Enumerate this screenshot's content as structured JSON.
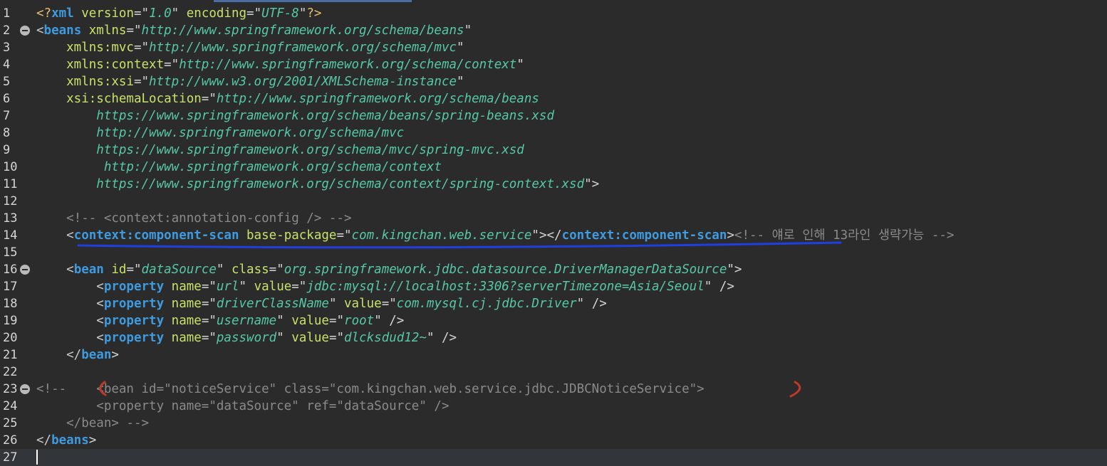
{
  "editor": {
    "colors": {
      "background": "#2b2b2b",
      "tag": "#3e9be0",
      "attribute": "#c7e26b",
      "value": "#56c7a8",
      "comment": "#8a8a8a"
    },
    "fold_icon": "fold-collapse-icon",
    "lines": [
      {
        "n": "1",
        "fold": false,
        "tokens": [
          {
            "t": "<?",
            "c": "pi"
          },
          {
            "t": "xml",
            "c": "tag"
          },
          {
            "t": " version",
            "c": "attr"
          },
          {
            "t": "=\"",
            "c": "punc"
          },
          {
            "t": "1.0",
            "c": "val"
          },
          {
            "t": "\"",
            "c": "punc"
          },
          {
            "t": " encoding",
            "c": "attr"
          },
          {
            "t": "=\"",
            "c": "punc"
          },
          {
            "t": "UTF-8",
            "c": "val"
          },
          {
            "t": "\"",
            "c": "punc"
          },
          {
            "t": "?>",
            "c": "pi"
          }
        ]
      },
      {
        "n": "2",
        "fold": true,
        "tokens": [
          {
            "t": "<",
            "c": "br"
          },
          {
            "t": "beans",
            "c": "tag"
          },
          {
            "t": " xmlns",
            "c": "attr"
          },
          {
            "t": "=\"",
            "c": "punc"
          },
          {
            "t": "http://www.springframework.org/schema/beans",
            "c": "val"
          },
          {
            "t": "\"",
            "c": "punc"
          }
        ]
      },
      {
        "n": "3",
        "fold": false,
        "tokens": [
          {
            "t": "    xmlns:mvc",
            "c": "attr"
          },
          {
            "t": "=\"",
            "c": "punc"
          },
          {
            "t": "http://www.springframework.org/schema/mvc",
            "c": "val"
          },
          {
            "t": "\"",
            "c": "punc"
          }
        ]
      },
      {
        "n": "4",
        "fold": false,
        "tokens": [
          {
            "t": "    xmlns:context",
            "c": "attr"
          },
          {
            "t": "=\"",
            "c": "punc"
          },
          {
            "t": "http://www.springframework.org/schema/context",
            "c": "val"
          },
          {
            "t": "\"",
            "c": "punc"
          }
        ]
      },
      {
        "n": "5",
        "fold": false,
        "tokens": [
          {
            "t": "    xmlns:xsi",
            "c": "attr"
          },
          {
            "t": "=\"",
            "c": "punc"
          },
          {
            "t": "http://www.w3.org/2001/XMLSchema-instance",
            "c": "val"
          },
          {
            "t": "\"",
            "c": "punc"
          }
        ]
      },
      {
        "n": "6",
        "fold": false,
        "tokens": [
          {
            "t": "    xsi:schemaLocation",
            "c": "attr"
          },
          {
            "t": "=\"",
            "c": "punc"
          },
          {
            "t": "http://www.springframework.org/schema/beans",
            "c": "val"
          }
        ]
      },
      {
        "n": "7",
        "fold": false,
        "tokens": [
          {
            "t": "        https://www.springframework.org/schema/beans/spring-beans.xsd",
            "c": "val"
          }
        ]
      },
      {
        "n": "8",
        "fold": false,
        "tokens": [
          {
            "t": "        http://www.springframework.org/schema/mvc",
            "c": "val"
          }
        ]
      },
      {
        "n": "9",
        "fold": false,
        "tokens": [
          {
            "t": "        https://www.springframework.org/schema/mvc/spring-mvc.xsd",
            "c": "val"
          }
        ]
      },
      {
        "n": "10",
        "fold": false,
        "tokens": [
          {
            "t": "         http://www.springframework.org/schema/context",
            "c": "val"
          }
        ]
      },
      {
        "n": "11",
        "fold": false,
        "tokens": [
          {
            "t": "        https://www.springframework.org/schema/context/spring-context.xsd",
            "c": "val"
          },
          {
            "t": "\">",
            "c": "punc"
          }
        ]
      },
      {
        "n": "12",
        "fold": false,
        "tokens": []
      },
      {
        "n": "13",
        "fold": false,
        "tokens": [
          {
            "t": "    <!-- <context:annotation-config /> -->",
            "c": "cmt"
          }
        ]
      },
      {
        "n": "14",
        "fold": false,
        "tokens": [
          {
            "t": "    <",
            "c": "br"
          },
          {
            "t": "context:component-scan",
            "c": "tag"
          },
          {
            "t": " base-package",
            "c": "attr"
          },
          {
            "t": "=\"",
            "c": "punc"
          },
          {
            "t": "com.kingchan.web.service",
            "c": "val"
          },
          {
            "t": "\"></",
            "c": "punc"
          },
          {
            "t": "context:component-scan",
            "c": "tag"
          },
          {
            "t": ">",
            "c": "punc"
          },
          {
            "t": "<!-- 얘로 인해 13라인 생략가능 -->",
            "c": "cmt"
          }
        ]
      },
      {
        "n": "15",
        "fold": false,
        "tokens": []
      },
      {
        "n": "16",
        "fold": true,
        "tokens": [
          {
            "t": "    <",
            "c": "br"
          },
          {
            "t": "bean",
            "c": "tag"
          },
          {
            "t": " id",
            "c": "attr"
          },
          {
            "t": "=\"",
            "c": "punc"
          },
          {
            "t": "dataSource",
            "c": "val"
          },
          {
            "t": "\"",
            "c": "punc"
          },
          {
            "t": " class",
            "c": "attr"
          },
          {
            "t": "=\"",
            "c": "punc"
          },
          {
            "t": "org.springframework.jdbc.datasource.DriverManagerDataSource",
            "c": "val"
          },
          {
            "t": "\">",
            "c": "punc"
          }
        ]
      },
      {
        "n": "17",
        "fold": false,
        "tokens": [
          {
            "t": "        <",
            "c": "br"
          },
          {
            "t": "property",
            "c": "tag"
          },
          {
            "t": " name",
            "c": "attr"
          },
          {
            "t": "=\"",
            "c": "punc"
          },
          {
            "t": "url",
            "c": "val"
          },
          {
            "t": "\"",
            "c": "punc"
          },
          {
            "t": " value",
            "c": "attr"
          },
          {
            "t": "=\"",
            "c": "punc"
          },
          {
            "t": "jdbc:mysql://localhost:3306?serverTimezone=Asia/Seoul",
            "c": "val"
          },
          {
            "t": "\" />",
            "c": "punc"
          }
        ]
      },
      {
        "n": "18",
        "fold": false,
        "tokens": [
          {
            "t": "        <",
            "c": "br"
          },
          {
            "t": "property",
            "c": "tag"
          },
          {
            "t": " name",
            "c": "attr"
          },
          {
            "t": "=\"",
            "c": "punc"
          },
          {
            "t": "driverClassName",
            "c": "val"
          },
          {
            "t": "\"",
            "c": "punc"
          },
          {
            "t": " value",
            "c": "attr"
          },
          {
            "t": "=\"",
            "c": "punc"
          },
          {
            "t": "com.mysql.cj.jdbc.Driver",
            "c": "val"
          },
          {
            "t": "\" />",
            "c": "punc"
          }
        ]
      },
      {
        "n": "19",
        "fold": false,
        "tokens": [
          {
            "t": "        <",
            "c": "br"
          },
          {
            "t": "property",
            "c": "tag"
          },
          {
            "t": " name",
            "c": "attr"
          },
          {
            "t": "=\"",
            "c": "punc"
          },
          {
            "t": "username",
            "c": "val"
          },
          {
            "t": "\"",
            "c": "punc"
          },
          {
            "t": " value",
            "c": "attr"
          },
          {
            "t": "=\"",
            "c": "punc"
          },
          {
            "t": "root",
            "c": "val"
          },
          {
            "t": "\" />",
            "c": "punc"
          }
        ]
      },
      {
        "n": "20",
        "fold": false,
        "tokens": [
          {
            "t": "        <",
            "c": "br"
          },
          {
            "t": "property",
            "c": "tag"
          },
          {
            "t": " name",
            "c": "attr"
          },
          {
            "t": "=\"",
            "c": "punc"
          },
          {
            "t": "password",
            "c": "val"
          },
          {
            "t": "\"",
            "c": "punc"
          },
          {
            "t": " value",
            "c": "attr"
          },
          {
            "t": "=\"",
            "c": "punc"
          },
          {
            "t": "dlcksdud12~",
            "c": "val"
          },
          {
            "t": "\" />",
            "c": "punc"
          }
        ]
      },
      {
        "n": "21",
        "fold": false,
        "tokens": [
          {
            "t": "    </",
            "c": "br"
          },
          {
            "t": "bean",
            "c": "tag"
          },
          {
            "t": ">",
            "c": "punc"
          }
        ]
      },
      {
        "n": "22",
        "fold": false,
        "tokens": []
      },
      {
        "n": "23",
        "fold": true,
        "tokens": [
          {
            "t": "<!--    <bean id=\"noticeService\" class=\"com.kingchan.web.service.jdbc.JDBCNoticeService\">",
            "c": "cmt"
          }
        ]
      },
      {
        "n": "24",
        "fold": false,
        "tokens": [
          {
            "t": "        <property name=\"dataSource\" ref=\"dataSource\" />",
            "c": "cmt"
          }
        ]
      },
      {
        "n": "25",
        "fold": false,
        "tokens": [
          {
            "t": "    </bean> -->",
            "c": "cmt"
          }
        ]
      },
      {
        "n": "26",
        "fold": false,
        "tokens": [
          {
            "t": "</",
            "c": "br"
          },
          {
            "t": "beans",
            "c": "tag"
          },
          {
            "t": ">",
            "c": "punc"
          }
        ]
      },
      {
        "n": "27",
        "fold": false,
        "current": true,
        "tokens": []
      }
    ]
  }
}
